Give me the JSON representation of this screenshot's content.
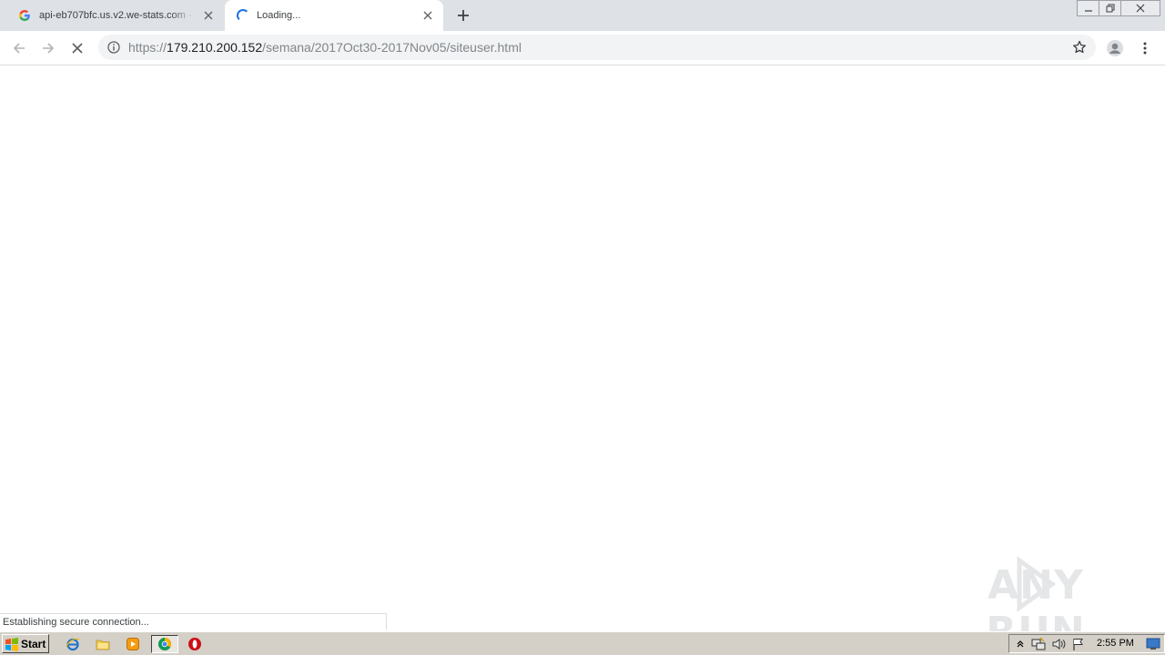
{
  "browser": {
    "tabs": [
      {
        "title": "api-eb707bfc.us.v2.we-stats.com - ·",
        "state": "inactive",
        "favicon": "google-g-icon"
      },
      {
        "title": "Loading...",
        "state": "active",
        "favicon": "loading-spinner-icon"
      }
    ],
    "address_bar": {
      "scheme": "https://",
      "host": "179.210.200.152",
      "path": "/semana/2017Oct30-2017Nov05/siteuser.html"
    },
    "status_text": "Establishing secure connection...",
    "colors": {
      "tabstrip": "#dee1e6",
      "accent": "#1a73e8",
      "omnibox": "#f1f3f4"
    }
  },
  "watermark": {
    "text": "ANY RUN"
  },
  "taskbar": {
    "start_label": "Start",
    "clock": "2:55 PM",
    "pinned": [
      "internet-explorer-icon",
      "file-explorer-icon",
      "media-player-icon",
      "chrome-icon",
      "opera-icon"
    ]
  }
}
